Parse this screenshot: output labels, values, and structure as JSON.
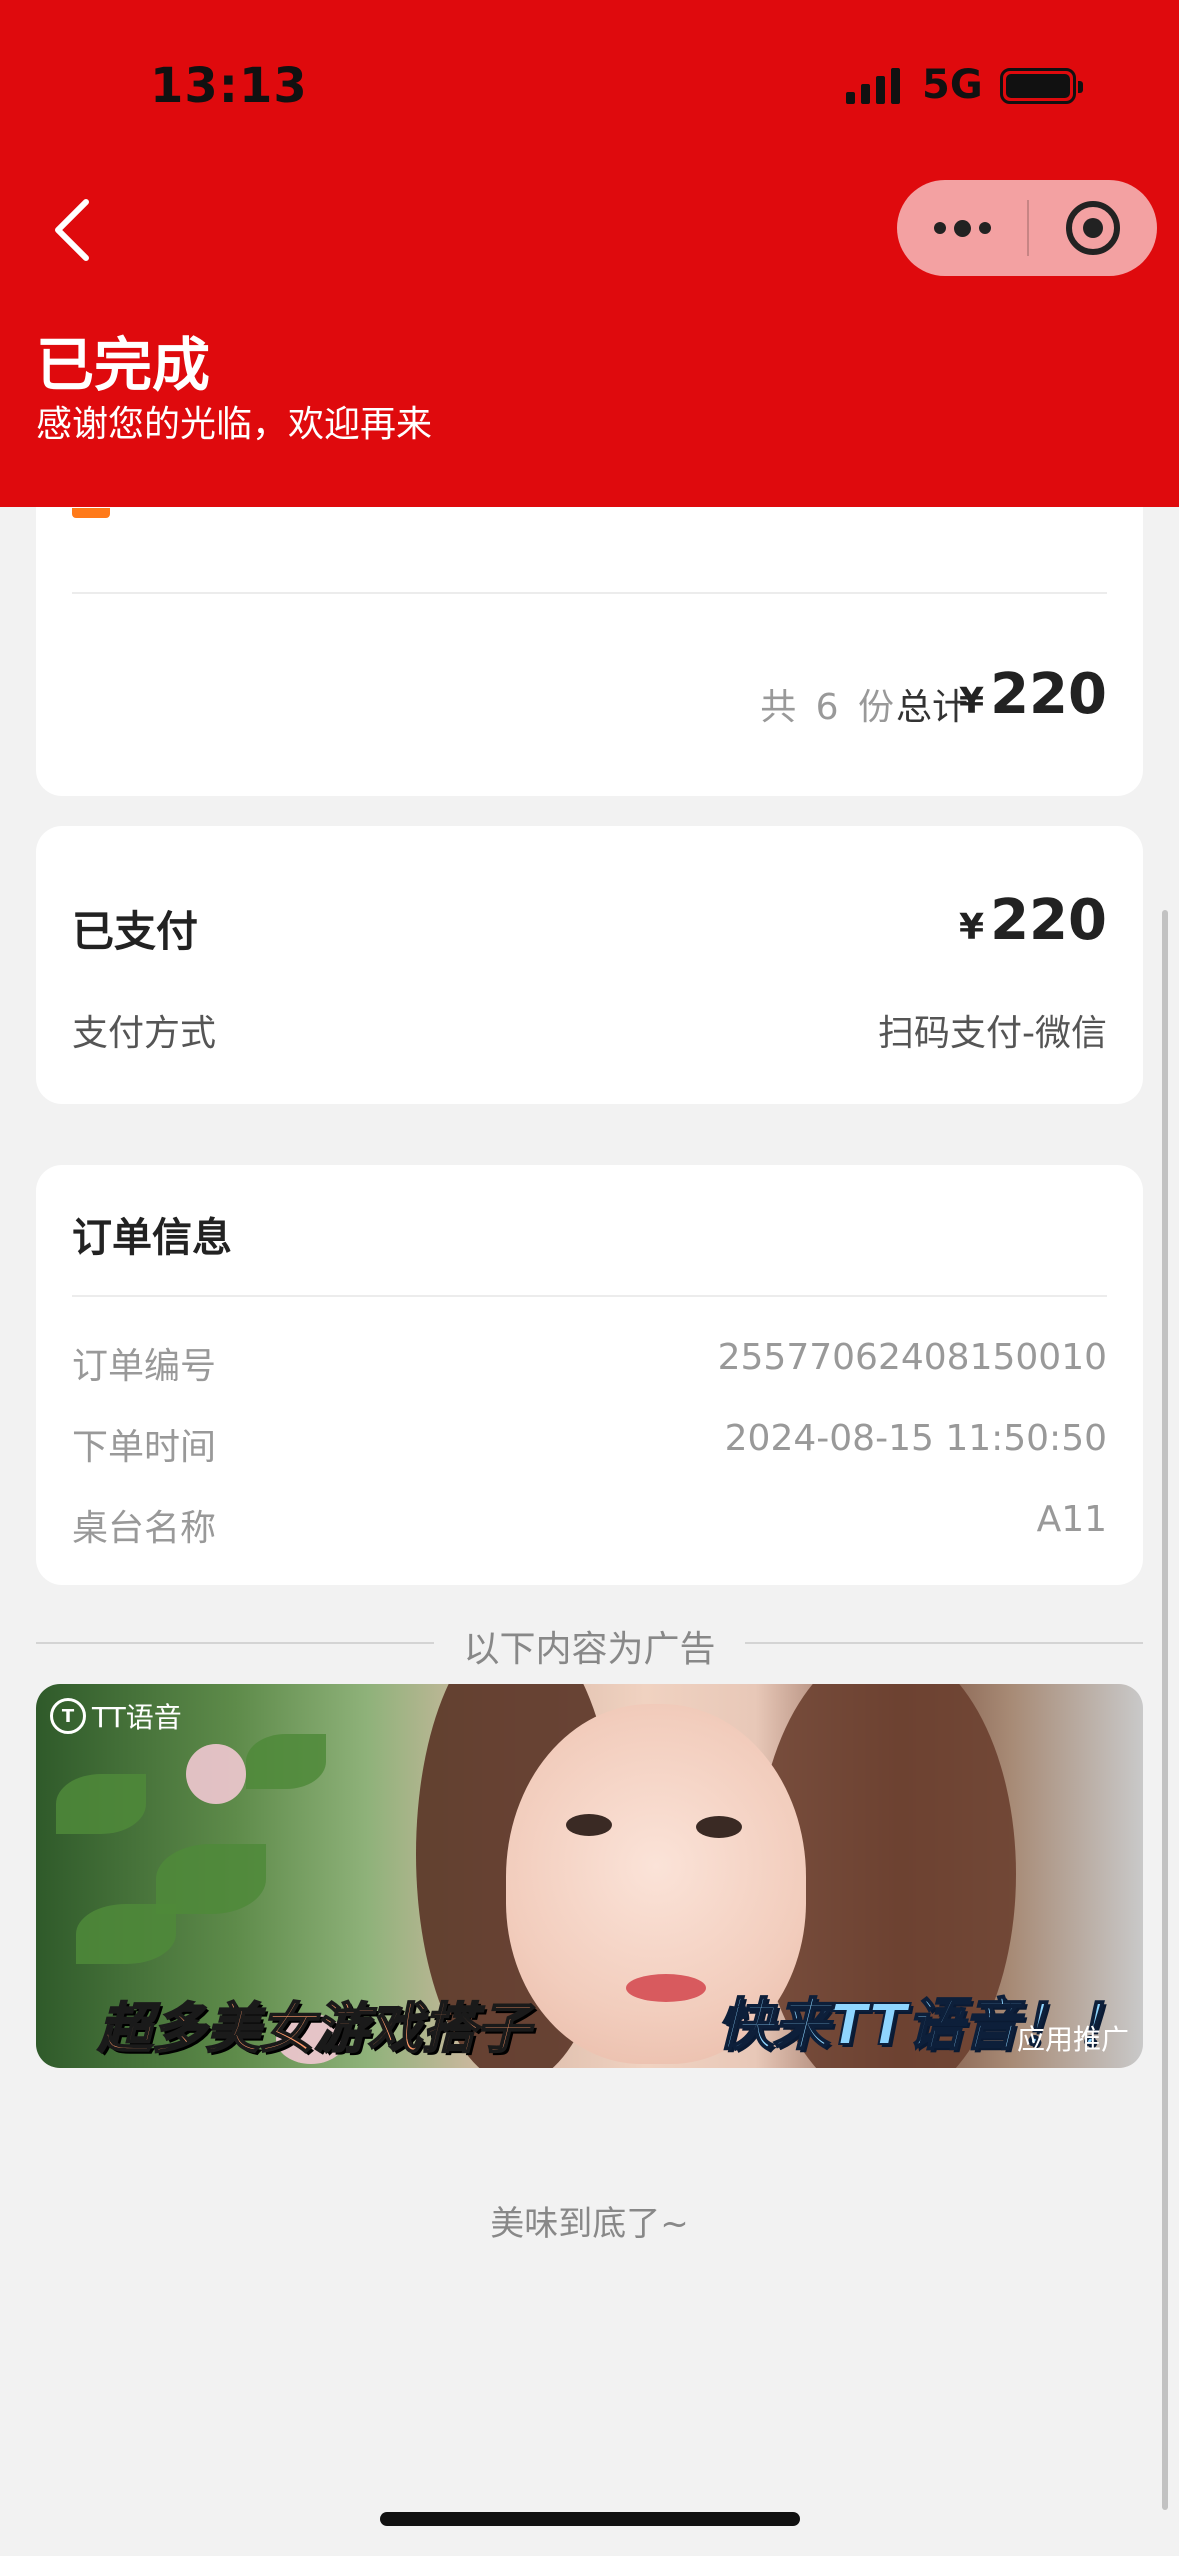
{
  "status_bar": {
    "time": "13:13",
    "network": "5G"
  },
  "header": {
    "title": "已完成",
    "subtitle": "感谢您的光临，欢迎再来"
  },
  "summary": {
    "count_text": "共 6 份",
    "total_label": "总计",
    "currency": "¥",
    "total_amount": "220"
  },
  "payment": {
    "paid_label": "已支付",
    "currency": "¥",
    "paid_amount": "220",
    "method_label": "支付方式",
    "method_value": "扫码支付-微信"
  },
  "order_info": {
    "title": "订单信息",
    "rows": [
      {
        "label": "订单编号",
        "value": "25577062408150010"
      },
      {
        "label": "下单时间",
        "value": "2024-08-15 11:50:50"
      },
      {
        "label": "桌台名称",
        "value": "A11"
      }
    ]
  },
  "ad": {
    "divider_text": "以下内容为广告",
    "brand": "TT语音",
    "slogan_left": "超多美女游戏搭子",
    "slogan_right": "快来TT语音！！",
    "tag": "应用推广"
  },
  "footer": {
    "end_text": "美味到底了~"
  },
  "colors": {
    "header_red": "#df0a0d",
    "background": "#f2f2f2"
  }
}
